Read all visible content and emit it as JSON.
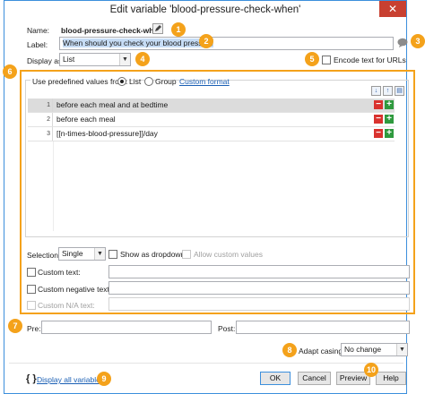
{
  "window": {
    "title": "Edit variable 'blood-pressure-check-when'",
    "close_glyph": "✕"
  },
  "name": {
    "label": "Name:",
    "value": "blood-pressure-check-when",
    "edit_icon": "pencil-icon"
  },
  "label_field": {
    "label": "Label:",
    "value": "When should you check your blood pressure",
    "comment_icon": "speech-bubble-icon"
  },
  "display": {
    "label": "Display as:",
    "value": "List"
  },
  "encode": {
    "label": "Encode text for URLs",
    "checked": false
  },
  "predefined": {
    "legend": "Use predefined values from:",
    "list_label": "List",
    "group_label": "Group",
    "selected": "List",
    "custom_format": "Custom format"
  },
  "values": [
    {
      "num": "1",
      "text": "before each meal and at bedtime"
    },
    {
      "num": "2",
      "text": "before each meal"
    },
    {
      "num": "3",
      "text": "[[n-times-blood-pressure]]/day"
    }
  ],
  "selection": {
    "label": "Selection:",
    "value": "Single",
    "show_dropdown": "Show as dropdown",
    "allow_custom": "Allow custom values"
  },
  "custom_text": {
    "label": "Custom text:"
  },
  "custom_negative": {
    "label": "Custom negative text:"
  },
  "custom_na": {
    "label": "Custom N/A text:"
  },
  "pre": {
    "label": "Pre:"
  },
  "post": {
    "label": "Post:"
  },
  "casing": {
    "label": "Adapt casing:",
    "value": "No change"
  },
  "footer": {
    "braces": "{ }",
    "display_all": "Display all variables"
  },
  "buttons": {
    "ok": "OK",
    "cancel": "Cancel",
    "preview": "Preview",
    "help": "Help"
  },
  "badges": [
    "1",
    "2",
    "3",
    "4",
    "5",
    "6",
    "7",
    "8",
    "9",
    "10"
  ],
  "colors": {
    "accent": "#f4a21b",
    "window_border": "#3c8fdc",
    "close": "#c84031",
    "minus": "#d9322e",
    "plus": "#2f9a3e",
    "selection": "#c6dcf5"
  }
}
